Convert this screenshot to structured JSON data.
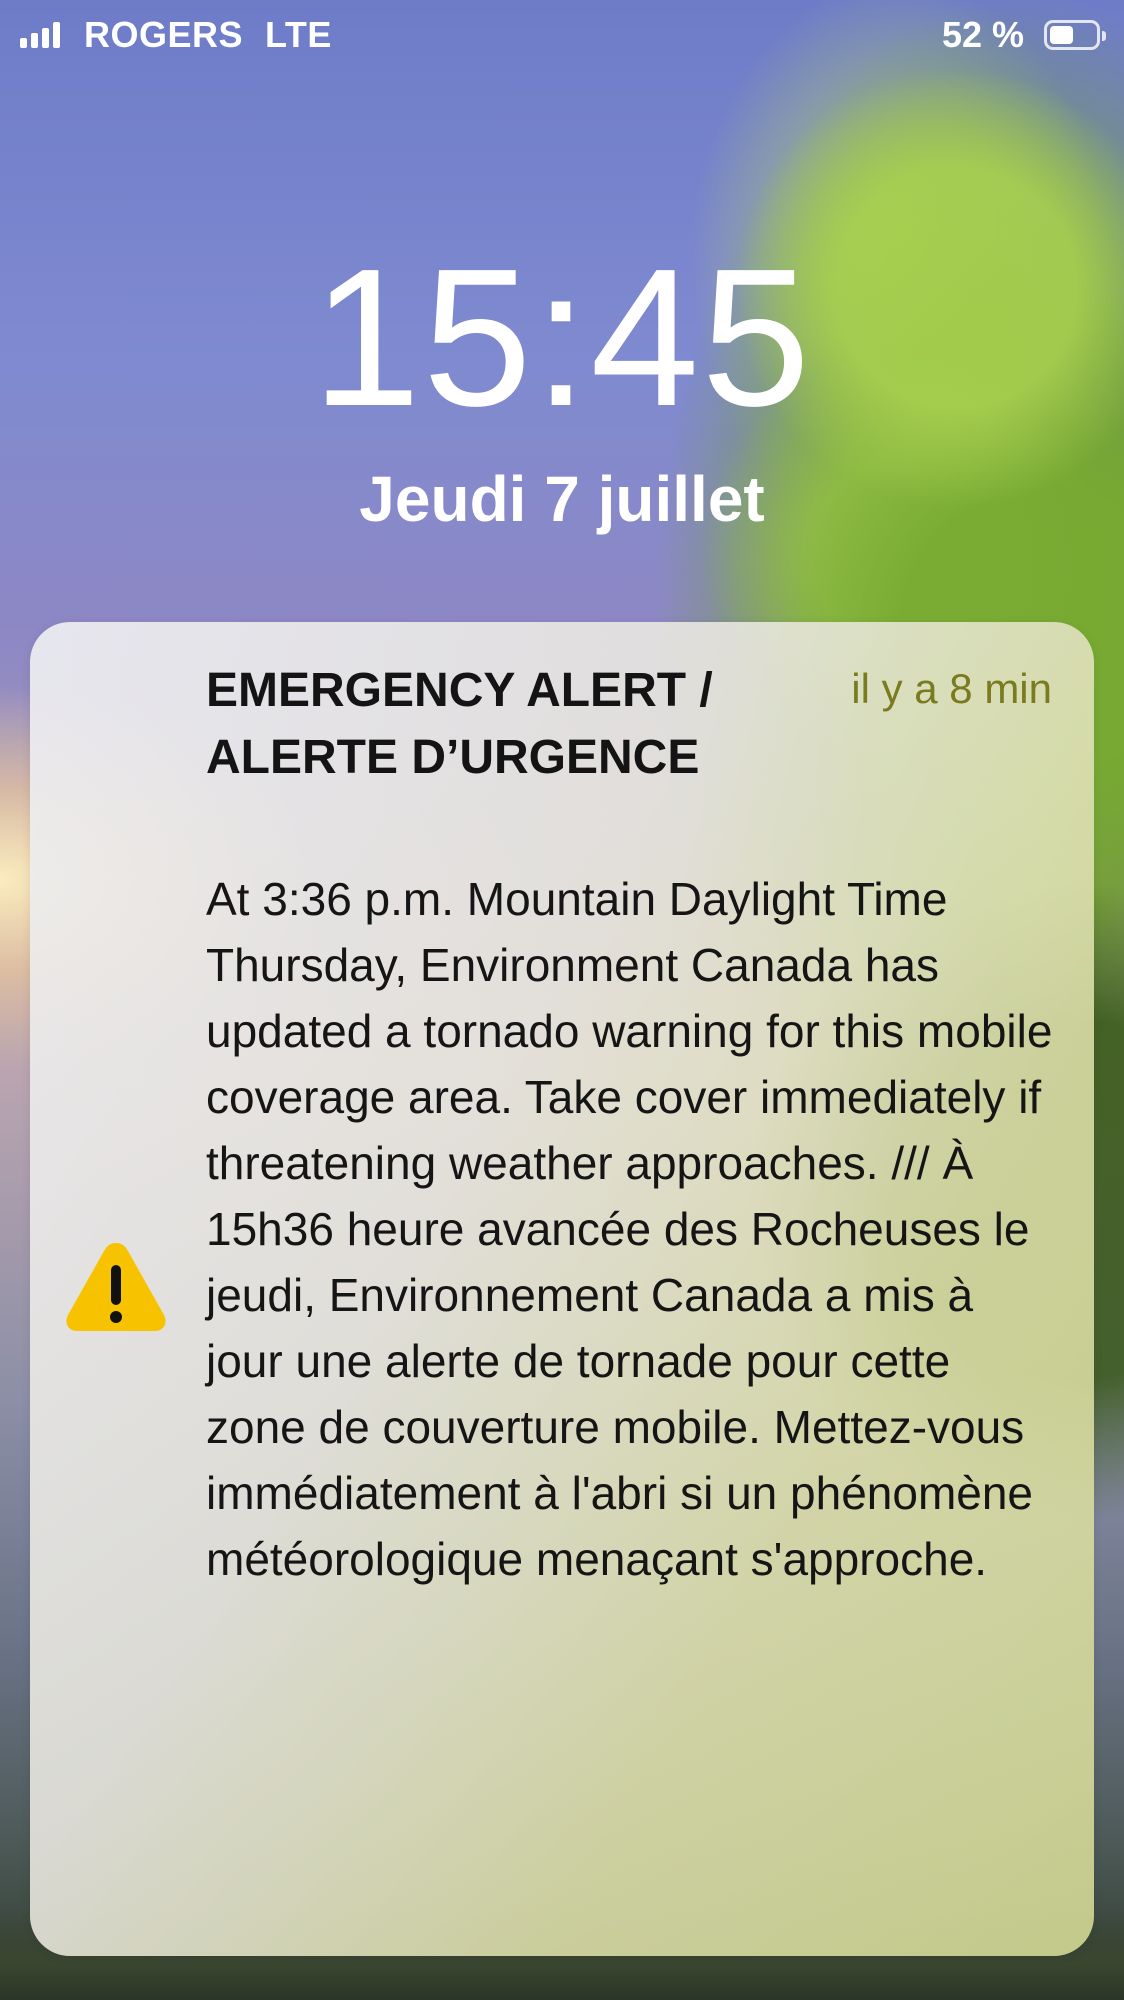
{
  "status_bar": {
    "carrier": "ROGERS",
    "network": "LTE",
    "battery_percent": "52 %",
    "battery_level": 0.52,
    "signal_bars": 4
  },
  "lock_screen": {
    "time": "15:45",
    "date": "Jeudi 7 juillet"
  },
  "notification": {
    "icon": "warning-icon",
    "title": "EMERGENCY ALERT / ALERTE D’URGENCE",
    "time_ago": "il y a 8 min",
    "body": "At 3:36 p.m. Mountain Daylight Time Thursday, Environment Canada has updated a tornado warning for this mobile coverage area. Take cover immediately if threatening weather approaches. /// À 15h36 heure avancée des Rocheuses le jeudi, Environnement Canada a mis à jour une alerte de tornade pour cette zone de couverture mobile. Mettez-vous immédiatement à l'abri si un phénomène météorologique menaçant s'approche.",
    "icon_color": "#F7C300"
  }
}
